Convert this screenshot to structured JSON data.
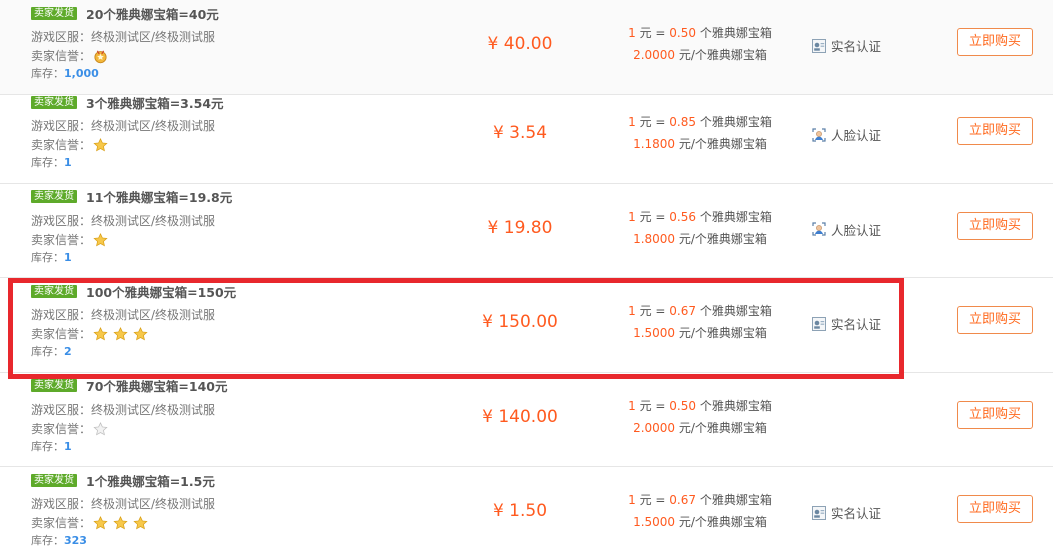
{
  "seller_badge": "卖家发货",
  "labels": {
    "server": "游戏区服：",
    "credit": "卖家信誉：",
    "stock": "库存：",
    "unit_yuan": "元 =",
    "per_unit": "个雅典娜宝箱",
    "yuan_per": "元/个雅典娜宝箱"
  },
  "accent_color": "#ff5a1f",
  "listings": [
    {
      "title": "20个雅典娜宝箱=40元",
      "server": "终极测试区/终极测试服",
      "credit": {
        "kind": "medal",
        "count": 1
      },
      "stock": "1,000",
      "price": "¥ 40.00",
      "ratio_lead": "1",
      "ratio_value": "0.50",
      "unit_price": "2.0000",
      "auth": "实名认证",
      "auth_icon": "id-card-icon",
      "buy": "立即购买"
    },
    {
      "title": "3个雅典娜宝箱=3.54元",
      "server": "终极测试区/终极测试服",
      "credit": {
        "kind": "star",
        "count": 1
      },
      "stock": "1",
      "price": "¥ 3.54",
      "ratio_lead": "1",
      "ratio_value": "0.85",
      "unit_price": "1.1800",
      "auth": "人脸认证",
      "auth_icon": "face-icon",
      "buy": "立即购买"
    },
    {
      "title": "11个雅典娜宝箱=19.8元",
      "server": "终极测试区/终极测试服",
      "credit": {
        "kind": "star",
        "count": 1
      },
      "stock": "1",
      "price": "¥ 19.80",
      "ratio_lead": "1",
      "ratio_value": "0.56",
      "unit_price": "1.8000",
      "auth": "人脸认证",
      "auth_icon": "face-icon",
      "buy": "立即购买"
    },
    {
      "title": "100个雅典娜宝箱=150元",
      "server": "终极测试区/终极测试服",
      "credit": {
        "kind": "star",
        "count": 3
      },
      "stock": "2",
      "price": "¥ 150.00",
      "ratio_lead": "1",
      "ratio_value": "0.67",
      "unit_price": "1.5000",
      "auth": "实名认证",
      "auth_icon": "id-card-icon",
      "buy": "立即购买"
    },
    {
      "title": "70个雅典娜宝箱=140元",
      "server": "终极测试区/终极测试服",
      "credit": {
        "kind": "star-empty",
        "count": 1
      },
      "stock": "1",
      "price": "¥ 140.00",
      "ratio_lead": "1",
      "ratio_value": "0.50",
      "unit_price": "2.0000",
      "auth": "",
      "auth_icon": "",
      "buy": "立即购买"
    },
    {
      "title": "1个雅典娜宝箱=1.5元",
      "server": "终极测试区/终极测试服",
      "credit": {
        "kind": "star",
        "count": 3
      },
      "stock": "323",
      "price": "¥ 1.50",
      "ratio_lead": "1",
      "ratio_value": "0.67",
      "unit_price": "1.5000",
      "auth": "实名认证",
      "auth_icon": "id-card-icon",
      "buy": "立即购买"
    }
  ]
}
